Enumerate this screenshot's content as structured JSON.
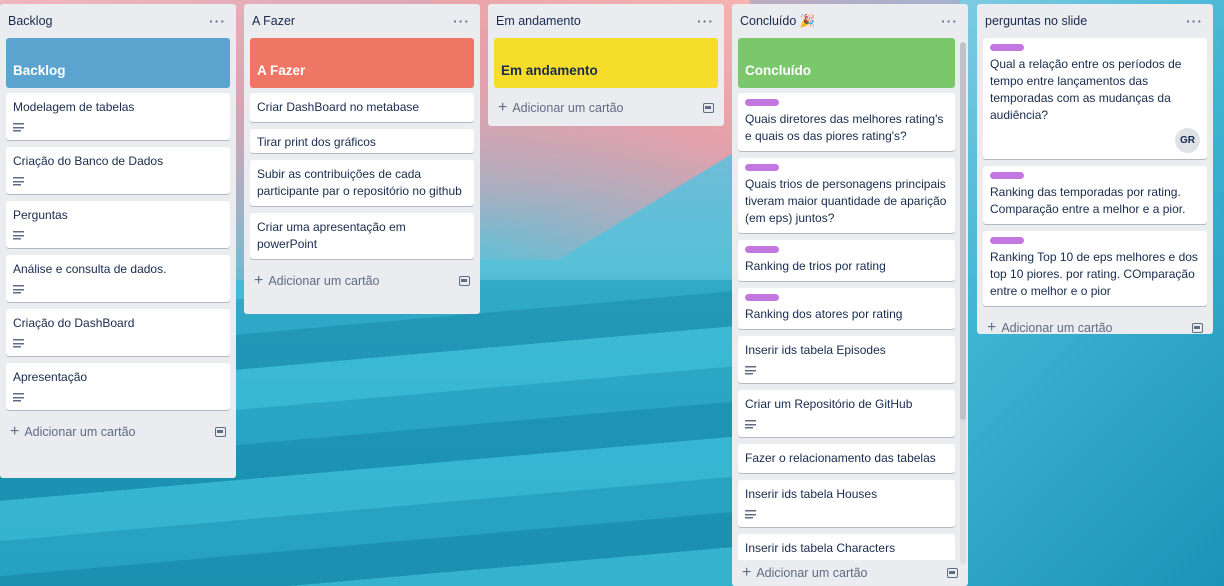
{
  "lists": [
    {
      "title": "Backlog",
      "cover": {
        "text": "Backlog",
        "color": "#5ba4cf"
      },
      "cards": [
        {
          "text": "Modelagem de tabelas"
        },
        {
          "text": "Criação do Banco de Dados"
        },
        {
          "text": "Perguntas"
        },
        {
          "text": "Análise e consulta de dados."
        },
        {
          "text": "Criação do DashBoard"
        },
        {
          "text": "Apresentação"
        }
      ],
      "add_label": "Adicionar um cartão"
    },
    {
      "title": "A Fazer",
      "cover": {
        "text": "A Fazer",
        "color": "#ef7564"
      },
      "cards": [
        {
          "text": "Criar DashBoard no metabase"
        },
        {
          "text": "Tirar print dos gráficos"
        },
        {
          "text": "Subir as contribuições de cada participante par o repositório no github"
        },
        {
          "text": "Criar uma apresentação em powerPoint"
        }
      ],
      "add_label": "Adicionar um cartão"
    },
    {
      "title": "Em andamento",
      "cover": {
        "text": "Em andamento",
        "color": "#f5dd29"
      },
      "add_label": "Adicionar um cartão"
    },
    {
      "title": "Concluído",
      "title_emoji": "🎉",
      "cover": {
        "text": "Concluído",
        "color": "#7bc86c"
      },
      "cards": [
        {
          "text": "Quais diretores das melhores rating's e quais os das piores rating's?"
        },
        {
          "text": "Quais trios de personagens principais tiveram maior quantidade de aparição (em eps) juntos?"
        },
        {
          "text": "Ranking de trios por rating"
        },
        {
          "text": "Ranking dos atores por rating"
        },
        {
          "text": "Inserir ids tabela Episodes"
        },
        {
          "text": "Criar um Repositório de GitHub"
        },
        {
          "text": "Fazer o relacionamento das tabelas"
        },
        {
          "text": "Inserir ids tabela Houses"
        },
        {
          "text": "Inserir ids tabela Characters"
        }
      ],
      "add_label": "Adicionar um cartão"
    },
    {
      "title": "perguntas no slide",
      "cards": [
        {
          "text": "Qual a relação entre os períodos de tempo entre lançamentos das temporadas com as mudanças da audiência?",
          "avatar": "GR"
        },
        {
          "text": "Ranking das temporadas por rating. Comparação entre a melhor e a pior."
        },
        {
          "text": "Ranking Top 10 de eps melhores e dos top 10 piores. por rating. COmparação entre o melhor e o pior"
        }
      ],
      "add_label": "Adicionar um cartão"
    }
  ],
  "colors": {
    "label_purple": "#c377e0",
    "list_bg": "#ebecf0"
  }
}
